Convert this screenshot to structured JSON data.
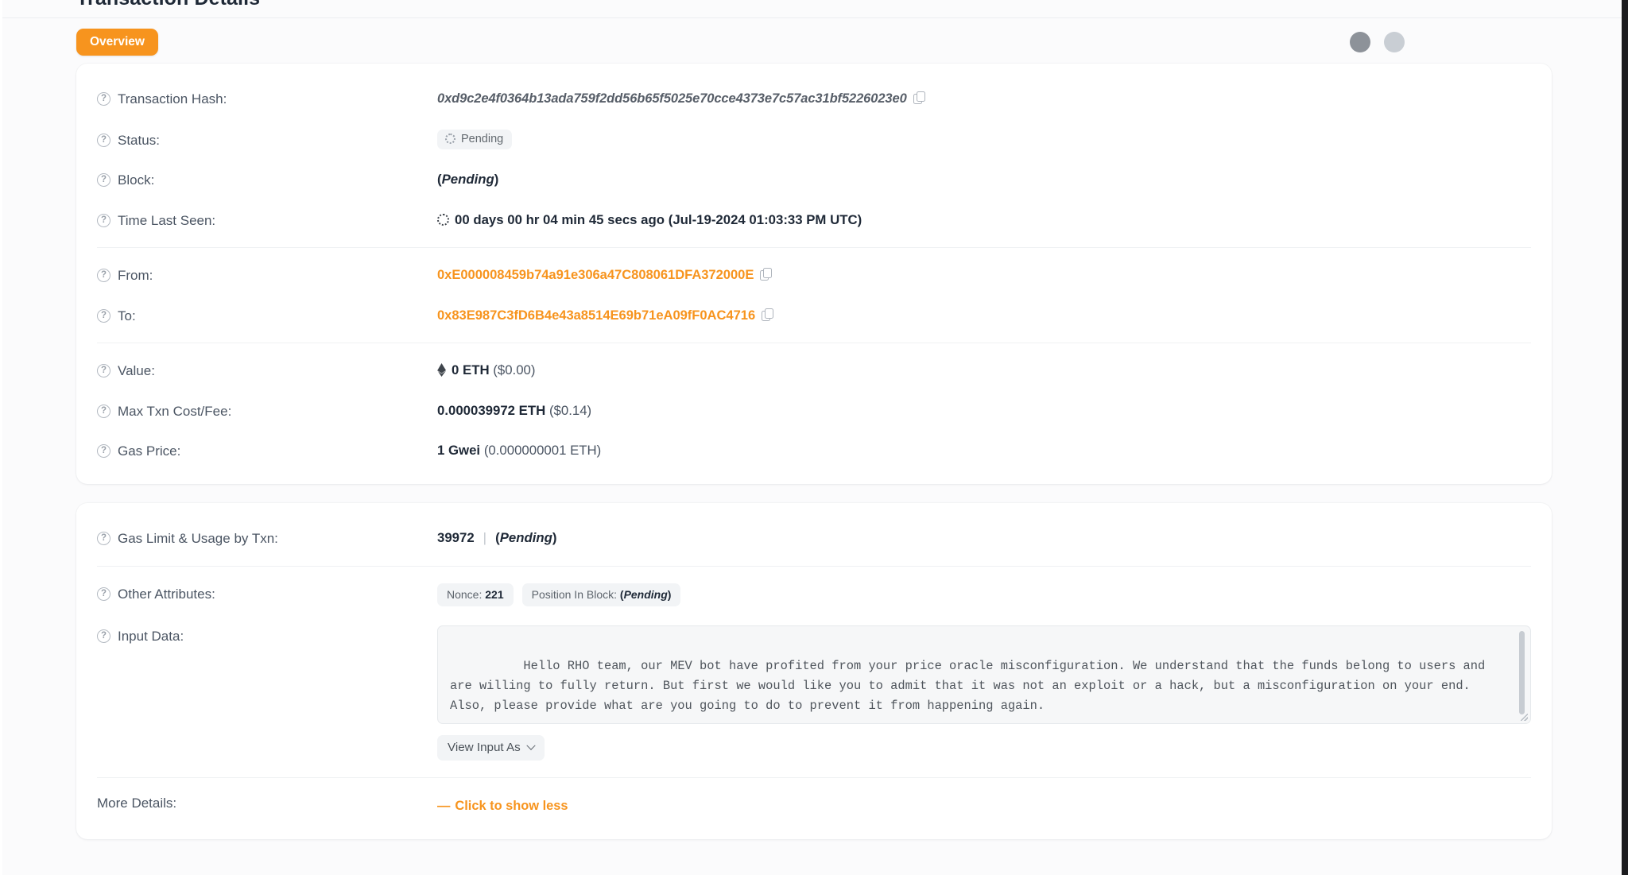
{
  "page": {
    "heading": "Transaction Details"
  },
  "tabs": {
    "overview_label": "Overview",
    "right_buttons": [
      {
        "name": "circle-button-dark",
        "color": "#8d9299"
      },
      {
        "name": "circle-button-light",
        "color": "#c9ced4"
      }
    ]
  },
  "overview": {
    "transaction_hash": {
      "label": "Transaction Hash:",
      "value": "0xd9c2e4f0364b13ada759f2dd56b65f5025e70cce4373e7c57ac31bf5226023e0",
      "copy_icon": "copy-icon"
    },
    "status": {
      "label": "Status:",
      "badge_text": "Pending",
      "badge_icon": "spinner-icon"
    },
    "block": {
      "label": "Block:",
      "open_paren": "(",
      "value": "Pending",
      "close_paren": ")"
    },
    "time_last_seen": {
      "label": "Time Last Seen:",
      "icon": "spinner-icon",
      "elapsed": "00 days 00 hr 04 min 45 secs ago",
      "timestamp": "(Jul-19-2024 01:03:33 PM UTC)"
    },
    "from": {
      "label": "From:",
      "value": "0xE000008459b74a91e306a47C808061DFA372000E",
      "copy_icon": "copy-icon"
    },
    "to": {
      "label": "To:",
      "value": "0x83E987C3fD6B4e43a8514E69b71eA09fF0AC4716",
      "copy_icon": "copy-icon"
    },
    "value": {
      "label": "Value:",
      "icon": "ethereum-icon",
      "amount": "0 ETH",
      "fiat": "($0.00)"
    },
    "max_txn_cost_fee": {
      "label": "Max Txn Cost/Fee:",
      "amount": "0.000039972 ETH",
      "fiat": "($0.14)"
    },
    "gas_price": {
      "label": "Gas Price:",
      "amount": "1 Gwei",
      "eth": "(0.000000001 ETH)"
    }
  },
  "details": {
    "gas_limit_usage": {
      "label": "Gas Limit & Usage by Txn:",
      "limit": "39972",
      "separator": "|",
      "usage_open": "(",
      "usage": "Pending",
      "usage_close": ")"
    },
    "other_attributes": {
      "label": "Other Attributes:",
      "nonce_prefix": "Nonce:",
      "nonce_value": "221",
      "position_prefix": "Position In Block:",
      "position_open": "(",
      "position_value": "Pending",
      "position_close": ")"
    },
    "input_data": {
      "label": "Input Data:",
      "text": "Hello RHO team, our MEV bot have profited from your price oracle misconfiguration. We understand that the funds belong to users and are willing to fully return. But first we would like you to admit that it was not an exploit or a hack, but a misconfiguration on your end. Also, please provide what are you going to do to prevent it from happening again.",
      "view_as_button": "View Input As",
      "chevron_icon": "chevron-down-icon"
    },
    "more_details": {
      "label": "More Details:",
      "dash": "—",
      "link_text": "Click to show less"
    }
  },
  "colors": {
    "accent_orange": "#f7941e",
    "page_background": "#fbfbfc",
    "card_background": "#ffffff",
    "muted_text": "#4b5563"
  }
}
